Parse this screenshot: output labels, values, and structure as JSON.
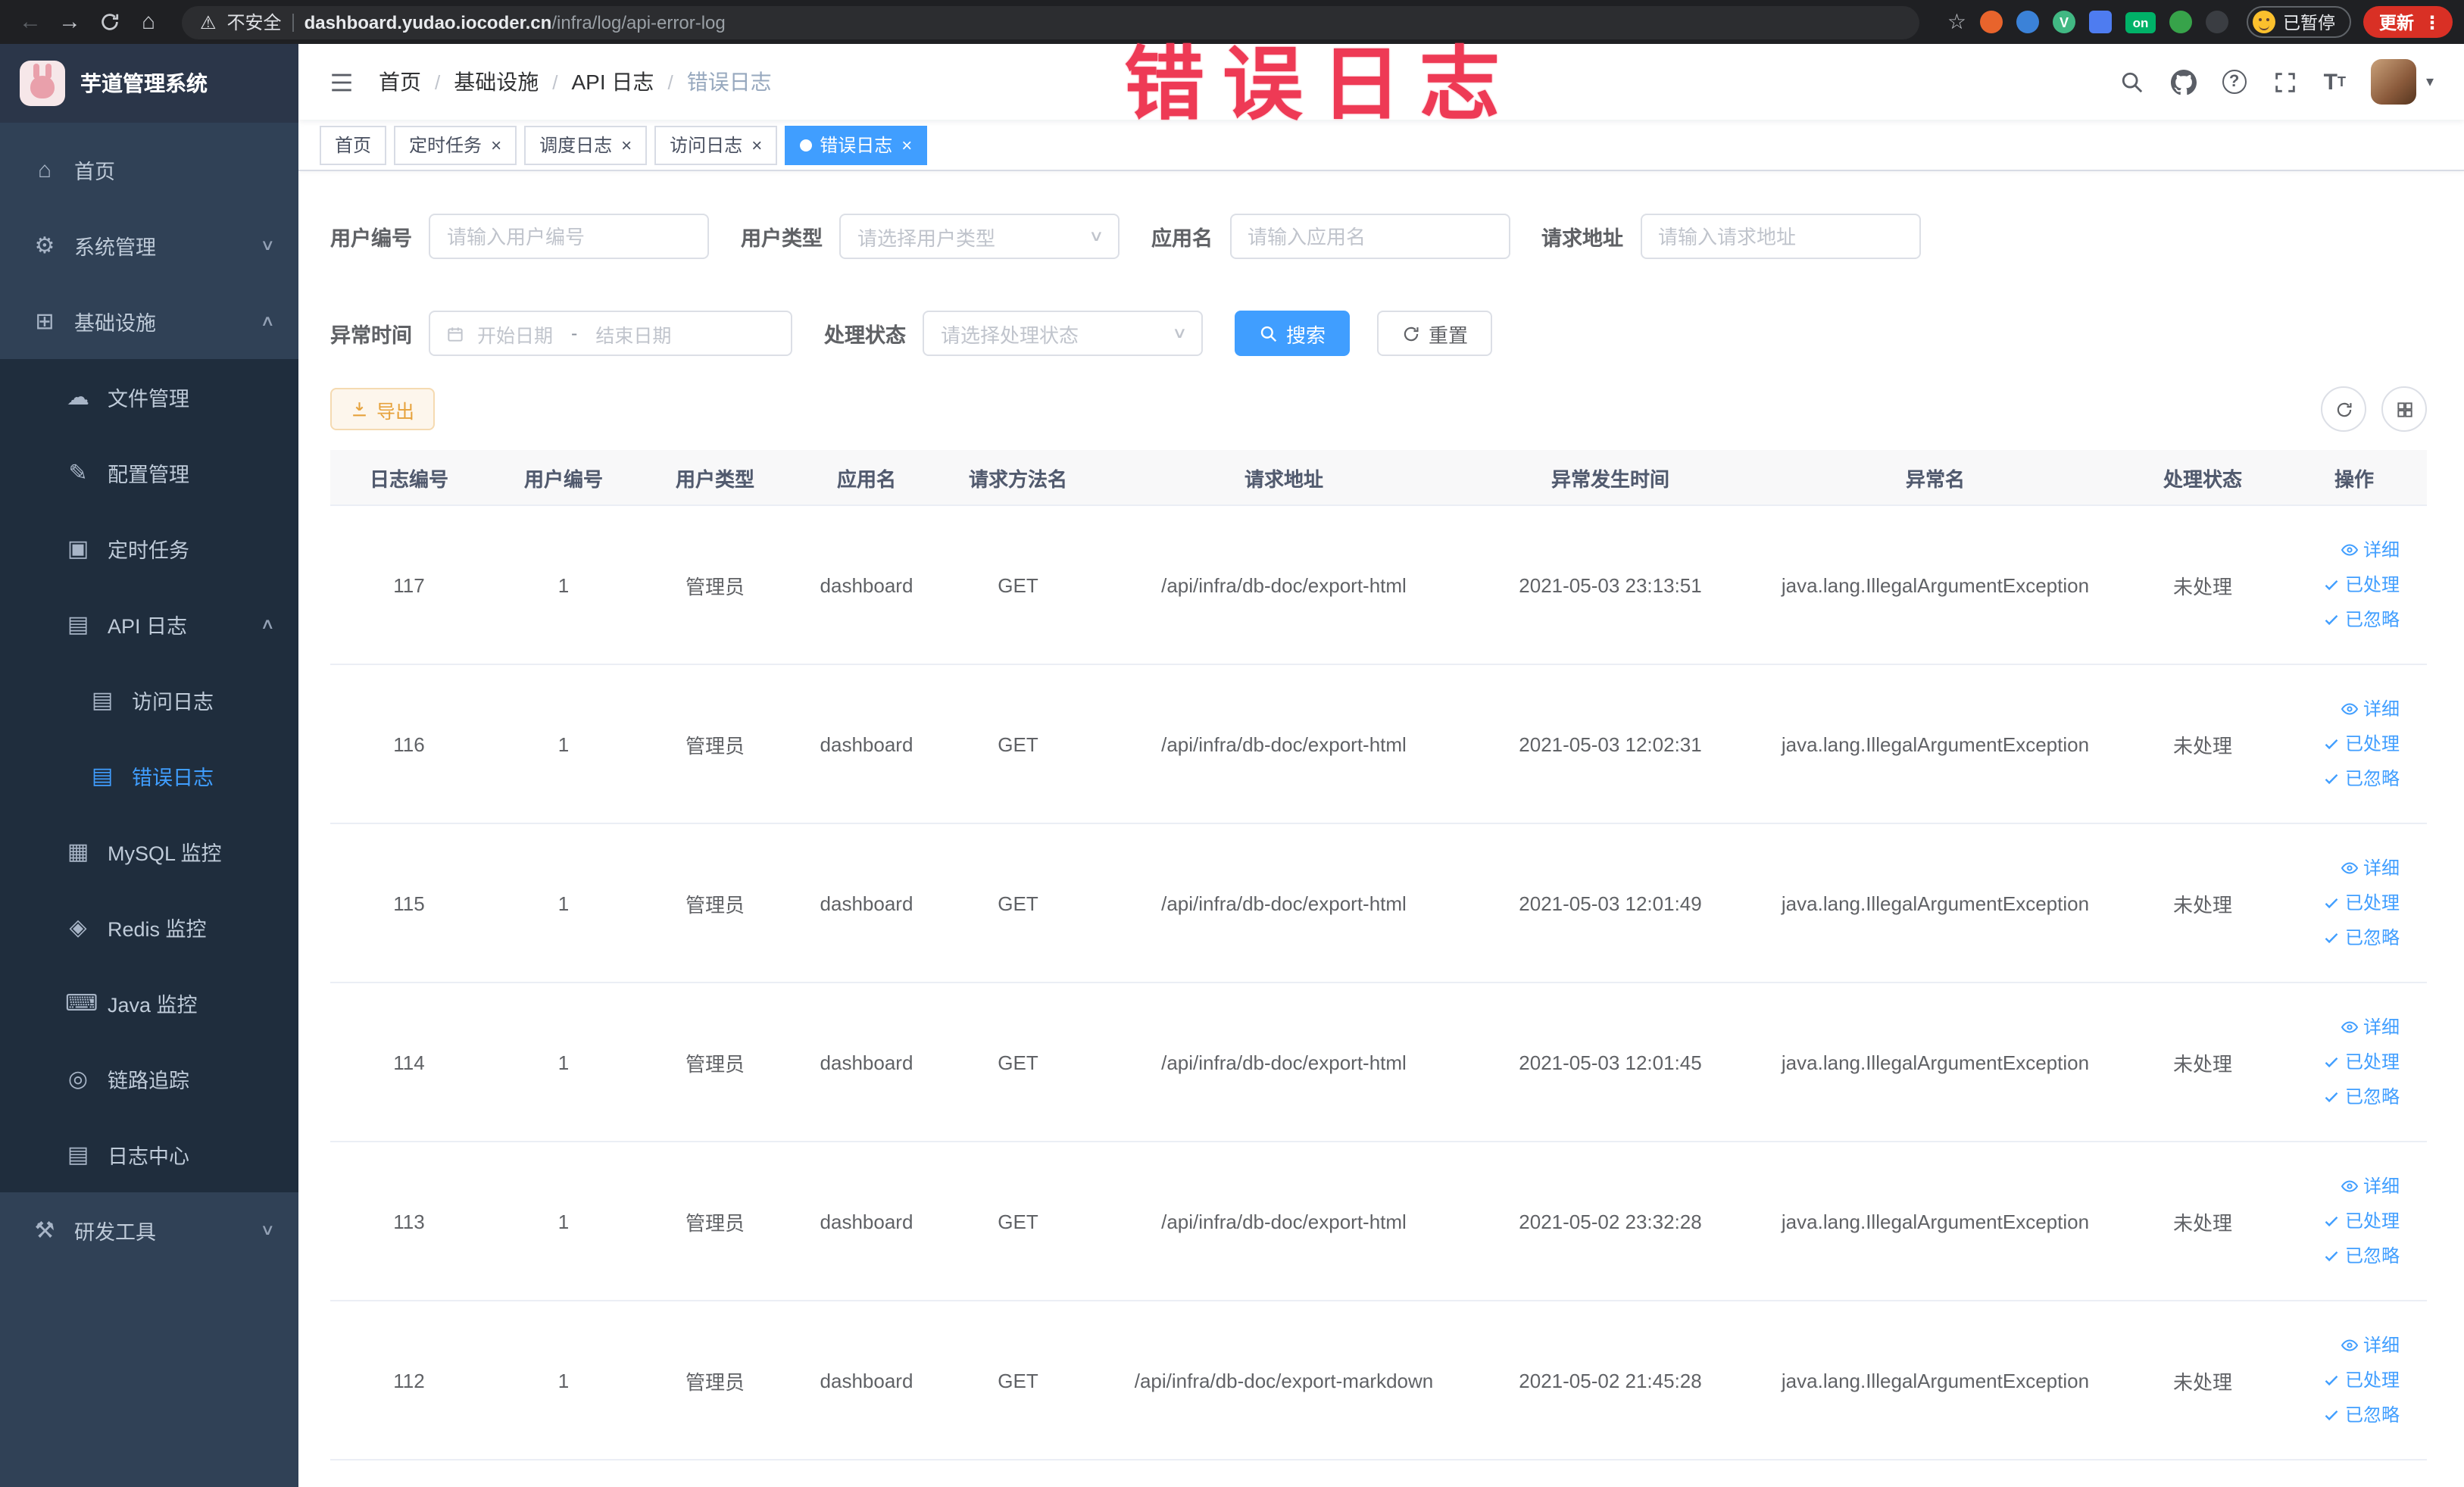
{
  "colors": {
    "accent": "#409eff",
    "warning": "#e6a23c",
    "annotation": "#ee3a55",
    "sidebar_bg": "#304156",
    "submenu_bg": "#1f2d3d"
  },
  "browser": {
    "security_label": "不安全",
    "url_domain": "dashboard.yudao.iocoder.cn",
    "url_path": "/infra/log/api-error-log",
    "extension_on_badge": "on",
    "paused_badge": "已暂停",
    "update_button": "更新"
  },
  "annotation": {
    "text": "错误日志",
    "color": "#ee3a55"
  },
  "sidebar": {
    "logo_title": "芋道管理系统",
    "menu": [
      {
        "name": "home",
        "label": "首页",
        "glyph": "⌂",
        "level": 1
      },
      {
        "name": "system-management",
        "label": "系统管理",
        "glyph": "⚙",
        "level": 1,
        "arrow": "down"
      },
      {
        "name": "infrastructure",
        "label": "基础设施",
        "glyph": "⊞",
        "level": 1,
        "arrow": "up"
      },
      {
        "name": "file-management",
        "label": "文件管理",
        "glyph": "☁",
        "level": 2
      },
      {
        "name": "config-management",
        "label": "配置管理",
        "glyph": "✎",
        "level": 2
      },
      {
        "name": "scheduled-jobs",
        "label": "定时任务",
        "glyph": "▣",
        "level": 2
      },
      {
        "name": "api-log",
        "label": "API 日志",
        "glyph": "▤",
        "level": 2,
        "arrow": "up"
      },
      {
        "name": "access-log",
        "label": "访问日志",
        "glyph": "▤",
        "level": 3
      },
      {
        "name": "error-log",
        "label": "错误日志",
        "glyph": "▤",
        "level": 3,
        "active": true
      },
      {
        "name": "mysql-monitor",
        "label": "MySQL 监控",
        "glyph": "▦",
        "level": 2
      },
      {
        "name": "redis-monitor",
        "label": "Redis 监控",
        "glyph": "◈",
        "level": 2
      },
      {
        "name": "java-monitor",
        "label": "Java 监控",
        "glyph": "⌨",
        "level": 2
      },
      {
        "name": "trace",
        "label": "链路追踪",
        "glyph": "◎",
        "level": 2
      },
      {
        "name": "log-center",
        "label": "日志中心",
        "glyph": "▤",
        "level": 2
      },
      {
        "name": "dev-tools",
        "label": "研发工具",
        "glyph": "⚒",
        "level": 1,
        "arrow": "down"
      }
    ]
  },
  "navbar": {
    "breadcrumb": [
      "首页",
      "基础设施",
      "API 日志",
      "错误日志"
    ]
  },
  "tabs": [
    {
      "label": "首页",
      "closable": false,
      "active": false
    },
    {
      "label": "定时任务",
      "closable": true,
      "active": false
    },
    {
      "label": "调度日志",
      "closable": true,
      "active": false
    },
    {
      "label": "访问日志",
      "closable": true,
      "active": false
    },
    {
      "label": "错误日志",
      "closable": true,
      "active": true
    }
  ],
  "filters": {
    "user_id_label": "用户编号",
    "user_id_placeholder": "请输入用户编号",
    "user_type_label": "用户类型",
    "user_type_placeholder": "请选择用户类型",
    "app_name_label": "应用名",
    "app_name_placeholder": "请输入应用名",
    "request_url_label": "请求地址",
    "request_url_placeholder": "请输入请求地址",
    "exception_time_label": "异常时间",
    "start_date_placeholder": "开始日期",
    "date_separator": "-",
    "end_date_placeholder": "结束日期",
    "process_status_label": "处理状态",
    "process_status_placeholder": "请选择处理状态",
    "search_button": "搜索",
    "reset_button": "重置"
  },
  "toolbar": {
    "export_button": "导出"
  },
  "table": {
    "headers": [
      "日志编号",
      "用户编号",
      "用户类型",
      "应用名",
      "请求方法名",
      "请求地址",
      "异常发生时间",
      "异常名",
      "处理状态",
      "操作"
    ],
    "actions": [
      "详细",
      "已处理",
      "已忽略"
    ],
    "rows": [
      {
        "id": "117",
        "user_id": "1",
        "user_type": "管理员",
        "app": "dashboard",
        "method": "GET",
        "url": "/api/infra/db-doc/export-html",
        "time": "2021-05-03 23:13:51",
        "exception": "java.lang.IllegalArgumentException",
        "status": "未处理"
      },
      {
        "id": "116",
        "user_id": "1",
        "user_type": "管理员",
        "app": "dashboard",
        "method": "GET",
        "url": "/api/infra/db-doc/export-html",
        "time": "2021-05-03 12:02:31",
        "exception": "java.lang.IllegalArgumentException",
        "status": "未处理"
      },
      {
        "id": "115",
        "user_id": "1",
        "user_type": "管理员",
        "app": "dashboard",
        "method": "GET",
        "url": "/api/infra/db-doc/export-html",
        "time": "2021-05-03 12:01:49",
        "exception": "java.lang.IllegalArgumentException",
        "status": "未处理"
      },
      {
        "id": "114",
        "user_id": "1",
        "user_type": "管理员",
        "app": "dashboard",
        "method": "GET",
        "url": "/api/infra/db-doc/export-html",
        "time": "2021-05-03 12:01:45",
        "exception": "java.lang.IllegalArgumentException",
        "status": "未处理"
      },
      {
        "id": "113",
        "user_id": "1",
        "user_type": "管理员",
        "app": "dashboard",
        "method": "GET",
        "url": "/api/infra/db-doc/export-html",
        "time": "2021-05-02 23:32:28",
        "exception": "java.lang.IllegalArgumentException",
        "status": "未处理"
      },
      {
        "id": "112",
        "user_id": "1",
        "user_type": "管理员",
        "app": "dashboard",
        "method": "GET",
        "url": "/api/infra/db-doc/export-markdown",
        "time": "2021-05-02 21:45:28",
        "exception": "java.lang.IllegalArgumentException",
        "status": "未处理"
      }
    ]
  }
}
